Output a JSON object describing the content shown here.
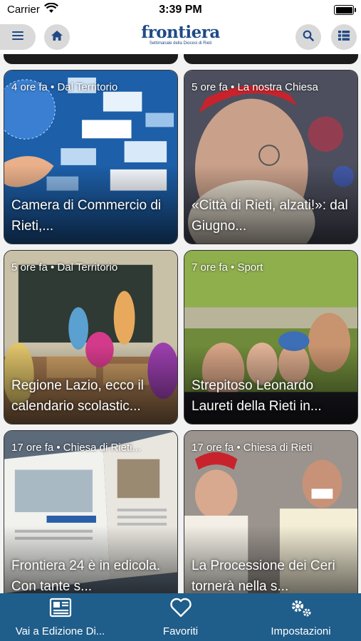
{
  "status_bar": {
    "carrier": "Carrier",
    "time": "3:39 PM"
  },
  "header": {
    "logo_name": "frontiera",
    "logo_subtitle": "Settimanale della Diocesi di Rieti"
  },
  "articles": [
    {
      "meta": "4 ore fa • Dal Territorio",
      "title": "Camera di Commercio di Rieti,..."
    },
    {
      "meta": "5 ore fa • La nostra Chiesa",
      "title": "«Città di Rieti, alzati!»: dal Giugno..."
    },
    {
      "meta": "5 ore fa • Dal Territorio",
      "title": "Regione Lazio, ecco il calendario scolastic..."
    },
    {
      "meta": "7 ore fa • Sport",
      "title": "Strepitoso Leonardo Laureti della Rieti in..."
    },
    {
      "meta": "17 ore fa • Chiesa di Rieti...",
      "title": "Frontiera 24 è in edicola. Con tante s..."
    },
    {
      "meta": "17 ore fa • Chiesa di Rieti",
      "title": "La Processione dei Ceri tornerà nella s..."
    }
  ],
  "tabbar": {
    "edition": "Vai a Edizione Di...",
    "favorites": "Favoriti",
    "settings": "Impostazioni"
  },
  "colors": {
    "brand": "#1f4a86",
    "tabbar": "#1f5d8a"
  }
}
